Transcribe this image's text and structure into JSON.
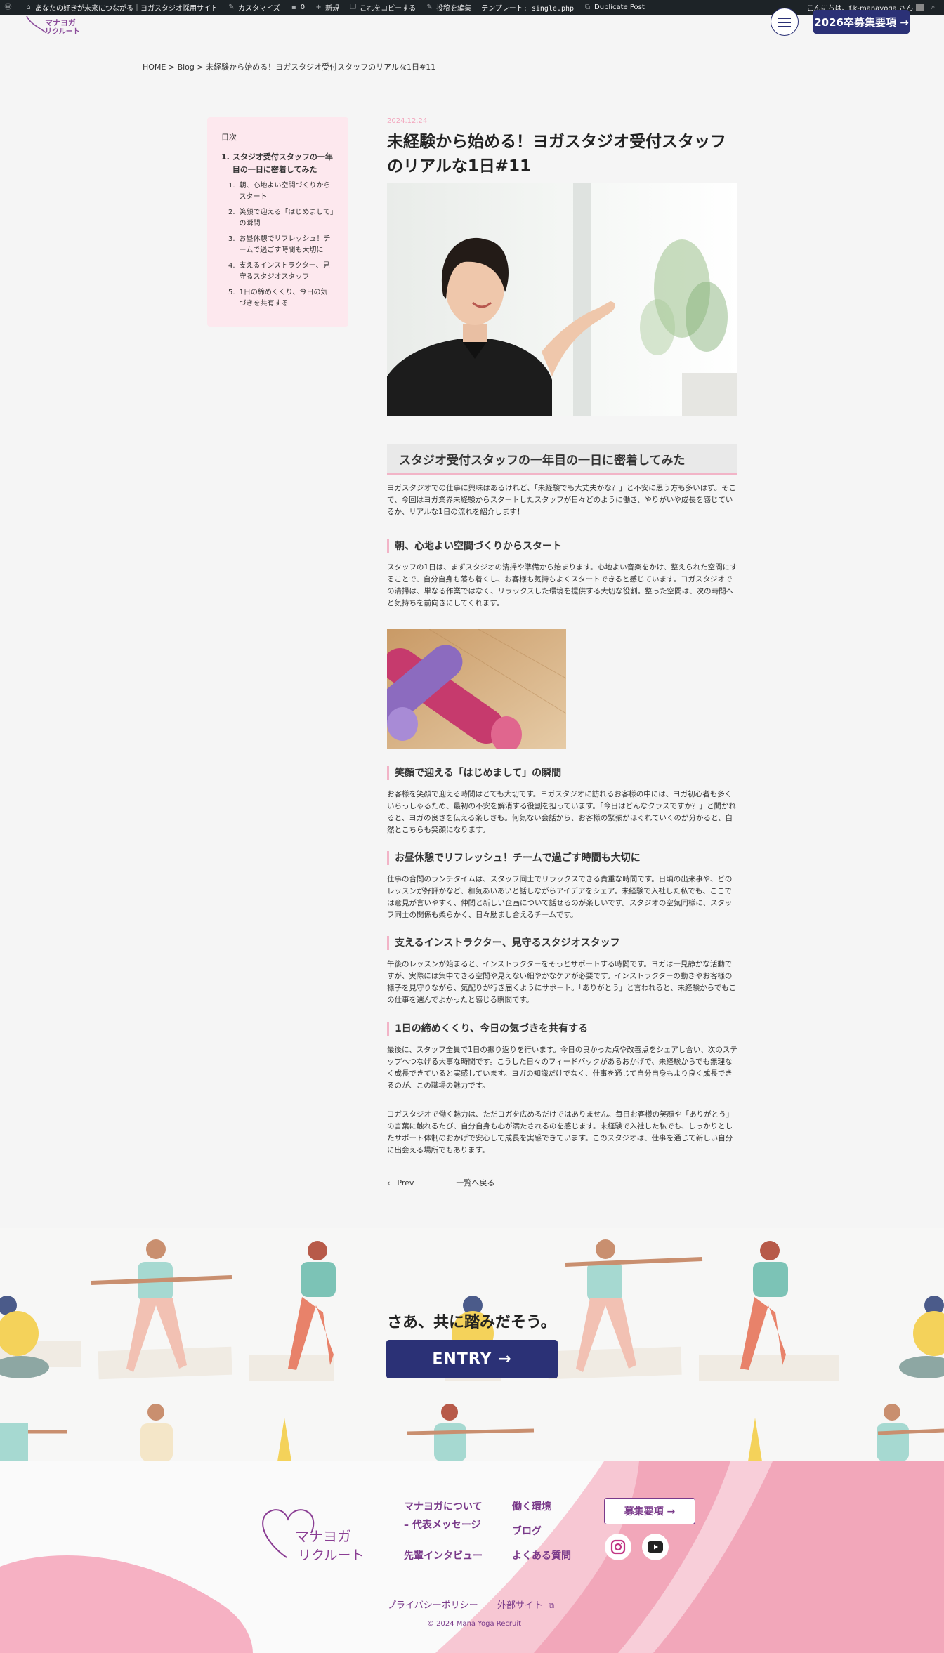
{
  "admin_bar": {
    "site_name": "あなたの好きが未来につながる｜ヨガスタジオ採用サイト",
    "customize": "カスタマイズ",
    "comments": "0",
    "new": "新規",
    "copy": "これをコピーする",
    "edit": "投稿を編集",
    "template": "テンプレート: single.php",
    "duplicate": "Duplicate Post",
    "greeting": "こんにちは、f.k-manayoga さん"
  },
  "header": {
    "recruit_button": "2026卒募集要項 →"
  },
  "breadcrumb": "HOME > Blog > 未経験から始める！ヨガスタジオ受付スタッフのリアルな1日#11",
  "toc": {
    "title": "目次",
    "main": {
      "num": "1.",
      "label": "スタジオ受付スタッフの一年目の一日に密着してみた"
    },
    "items": [
      {
        "num": "1.",
        "label": "朝、心地よい空間づくりからスタート"
      },
      {
        "num": "2.",
        "label": "笑顔で迎える「はじめまして」の瞬間"
      },
      {
        "num": "3.",
        "label": "お昼休憩でリフレッシュ！チームで過ごす時間も大切に"
      },
      {
        "num": "4.",
        "label": "支えるインストラクター、見守るスタジオスタッフ"
      },
      {
        "num": "5.",
        "label": "1日の締めくくり、今日の気づきを共有する"
      }
    ]
  },
  "article": {
    "date": "2024.12.24",
    "title": "未経験から始める！ヨガスタジオ受付スタッフのリアルな1日#11",
    "h2": "スタジオ受付スタッフの一年目の一日に密着してみた",
    "intro": "ヨガスタジオでの仕事に興味はあるけれど、「未経験でも大丈夫かな？」と不安に思う方も多いはず。そこで、今回はヨガ業界未経験からスタートしたスタッフが日々どのように働き、やりがいや成長を感じているか、リアルな1日の流れを紹介します！",
    "sections": [
      {
        "heading": "朝、心地よい空間づくりからスタート",
        "text": "スタッフの1日は、まずスタジオの清掃や準備から始まります。心地よい音楽をかけ、整えられた空間にすることで、自分自身も落ち着くし、お客様も気持ちよくスタートできると感じています。ヨガスタジオでの清掃は、単なる作業ではなく、リラックスした環境を提供する大切な役割。整った空間は、次の時間へと気持ちを前向きにしてくれます。"
      },
      {
        "heading": "笑顔で迎える「はじめまして」の瞬間",
        "text": "お客様を笑顔で迎える時間はとても大切です。ヨガスタジオに訪れるお客様の中には、ヨガ初心者も多くいらっしゃるため、最初の不安を解消する役割を担っています。「今日はどんなクラスですか？」と聞かれると、ヨガの良さを伝える楽しさも。何気ない会話から、お客様の緊張がほぐれていくのが分かると、自然とこちらも笑顔になります。"
      },
      {
        "heading": "お昼休憩でリフレッシュ！チームで過ごす時間も大切に",
        "text": "仕事の合間のランチタイムは、スタッフ同士でリラックスできる貴重な時間です。日頃の出来事や、どのレッスンが好評かなど、和気あいあいと話しながらアイデアをシェア。未経験で入社した私でも、ここでは意見が言いやすく、仲間と新しい企画について話せるのが楽しいです。スタジオの空気同様に、スタッフ同士の関係も柔らかく、日々励まし合えるチームです。"
      },
      {
        "heading": "支えるインストラクター、見守るスタジオスタッフ",
        "text": "午後のレッスンが始まると、インストラクターをそっとサポートする時間です。ヨガは一見静かな活動ですが、実際には集中できる空間や見えない細やかなケアが必要です。インストラクターの動きやお客様の様子を見守りながら、気配りが行き届くようにサポート。「ありがとう」と言われると、未経験からでもこの仕事を選んでよかったと感じる瞬間です。"
      },
      {
        "heading": "1日の締めくくり、今日の気づきを共有する",
        "text": "最後に、スタッフ全員で1日の振り返りを行います。今日の良かった点や改善点をシェアし合い、次のステップへつなげる大事な時間です。こうした日々のフィードバックがあるおかげで、未経験からでも無理なく成長できていると実感しています。ヨガの知識だけでなく、仕事を通じて自分自身もより良く成長できるのが、この職場の魅力です。"
      }
    ],
    "closing": "ヨガスタジオで働く魅力は、ただヨガを広めるだけではありません。毎日お客様の笑顔や「ありがとう」の言葉に触れるたび、自分自身も心が満たされるのを感じます。未経験で入社した私でも、しっかりとしたサポート体制のおかげで安心して成長を実感できています。このスタジオは、仕事を通じて新しい自分に出会える場所でもあります。",
    "prev": "Prev",
    "back": "一覧へ戻る"
  },
  "entry": {
    "copy": "さあ、共に踏みだそう。",
    "button": "ENTRY →"
  },
  "footer": {
    "logo_text": [
      "マナヨガ",
      "リクルート"
    ],
    "links": {
      "about": "マナヨガについて",
      "message": "– 代表メッセージ",
      "interview": "先輩インタビュー",
      "environment": "働く環境",
      "blog": "ブログ",
      "faq": "よくある質問"
    },
    "recruit_button": "募集要項 →",
    "privacy": "プライバシーポリシー",
    "external": "外部サイト",
    "copyright": "© 2024 Mana Yoga Recruit"
  },
  "colors": {
    "navy": "#2b3176",
    "pink_light": "#fde8ee",
    "accent_pink": "#f2b4c7",
    "purple": "#7a3a8a"
  }
}
